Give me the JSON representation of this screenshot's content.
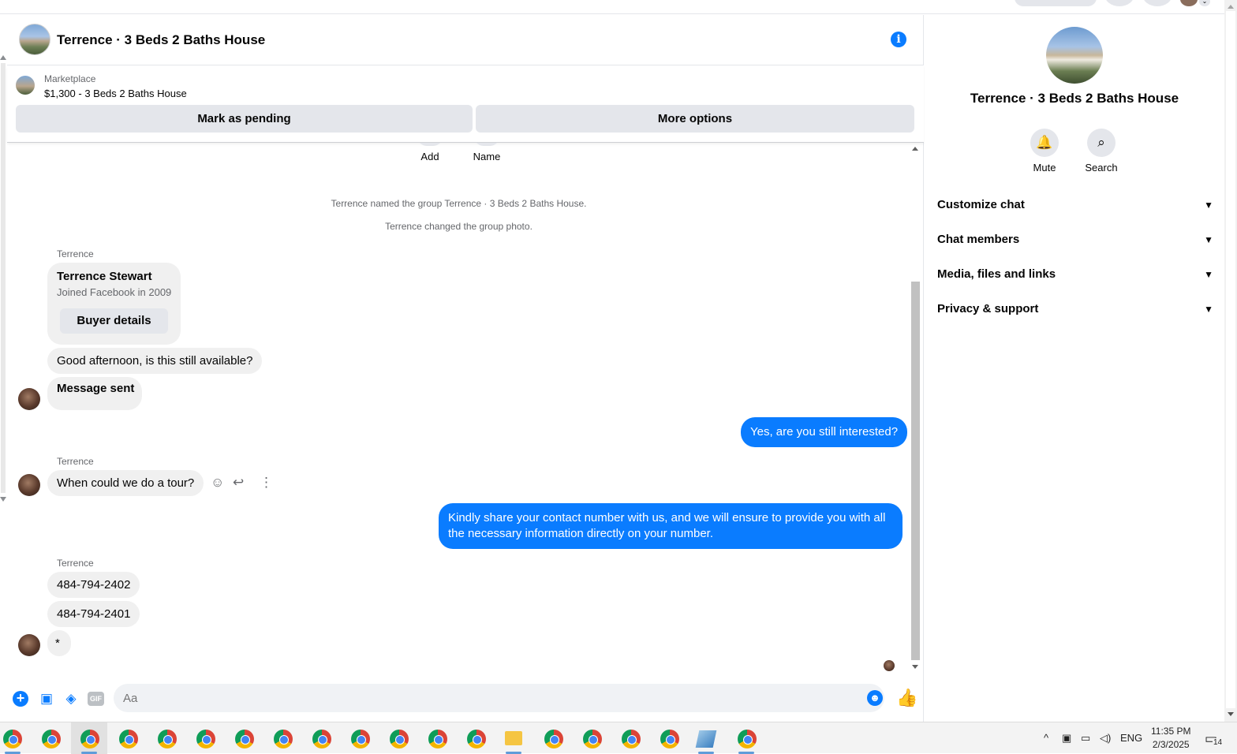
{
  "chat": {
    "title": "Terrence · 3 Beds 2 Baths House",
    "info_icon": "i",
    "marketplace": {
      "label": "Marketplace",
      "listing": "$1,300 - 3 Beds 2 Baths House",
      "pending_button": "Mark as pending",
      "more_button": "More options"
    },
    "actions": [
      {
        "label": "Add"
      },
      {
        "label": "Name"
      }
    ],
    "system_messages": [
      "Terrence named the group Terrence · 3 Beds 2 Baths House.",
      "Terrence changed the group photo."
    ],
    "sender_name": "Terrence",
    "buyer_card": {
      "name": "Terrence Stewart",
      "joined": "Joined Facebook in 2009",
      "button": "Buyer details"
    },
    "messages": {
      "m1": "Good afternoon, is this still available?",
      "m2": "Message sent",
      "m3": "Yes, are you still interested?",
      "m4": "When could we do a tour?",
      "m5": "Kindly share your contact number with us, and we will ensure to provide you with all the necessary information directly on your number.",
      "m6": "484-794-2402",
      "m7": "484-794-2401",
      "m8": "*"
    },
    "composer": {
      "placeholder": "Aa",
      "gif_label": "GIF"
    }
  },
  "panel": {
    "title": "Terrence · 3 Beds 2 Baths House",
    "mute_label": "Mute",
    "search_label": "Search",
    "sections": [
      "Customize chat",
      "Chat members",
      "Media, files and links",
      "Privacy & support"
    ]
  },
  "taskbar": {
    "language": "ENG",
    "time": "11:35 PM",
    "date": "2/3/2025",
    "notification_count": "14"
  },
  "colors": {
    "accent": "#0a7cff",
    "incoming_bubble": "#f0f0f0",
    "button_bg": "#e4e6eb"
  }
}
